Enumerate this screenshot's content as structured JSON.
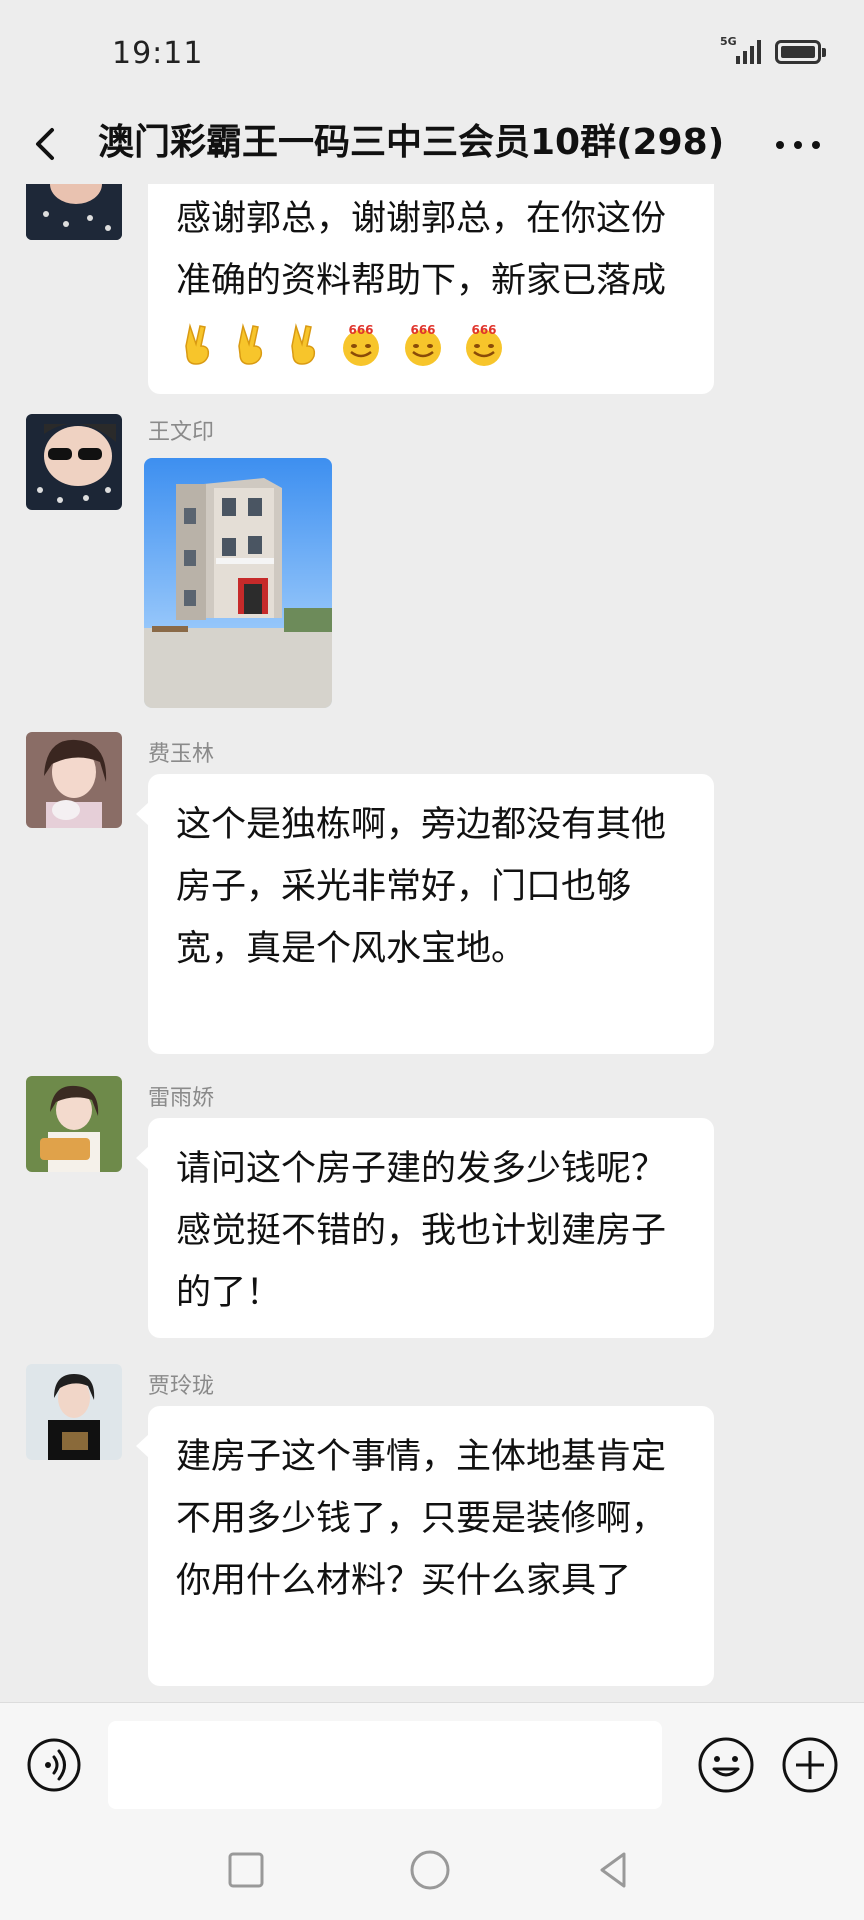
{
  "status_bar": {
    "time": "19:11",
    "network": "5G"
  },
  "header": {
    "title": "澳门彩霸王一码三中三会员10群(298)",
    "back_icon": "chevron-left-icon",
    "more_icon": "more-dots-icon"
  },
  "messages": [
    {
      "sender": "",
      "text": "感谢郭总，谢谢郭总，在你这份准确的资料帮助下，新家已落成",
      "emojis": [
        "victory-hand",
        "victory-hand",
        "victory-hand",
        "666-face",
        "666-face",
        "666-face"
      ],
      "emoji_text": "666"
    },
    {
      "sender": "王文印",
      "type": "image",
      "image_alt": "three-story house photo"
    },
    {
      "sender": "费玉林",
      "text": "这个是独栋啊，旁边都没有其他房子，采光非常好，门口也够宽，真是个风水宝地。"
    },
    {
      "sender": "雷雨娇",
      "text": "请问这个房子建的发多少钱呢？感觉挺不错的，我也计划建房子的了！"
    },
    {
      "sender": "贾玲珑",
      "text": "建房子这个事情，主体地基肯定不用多少钱了，只要是装修啊，你用什么材料？买什么家具了"
    }
  ],
  "input_bar": {
    "placeholder": "",
    "voice_icon": "voice-icon",
    "emoji_icon": "emoji-icon",
    "plus_icon": "plus-icon"
  },
  "colors": {
    "background": "#ededed",
    "bubble": "#ffffff",
    "sender_name": "#8a8a8a",
    "emoji_yellow": "#f7c52b",
    "emoji_red_text": "#e0342c"
  }
}
